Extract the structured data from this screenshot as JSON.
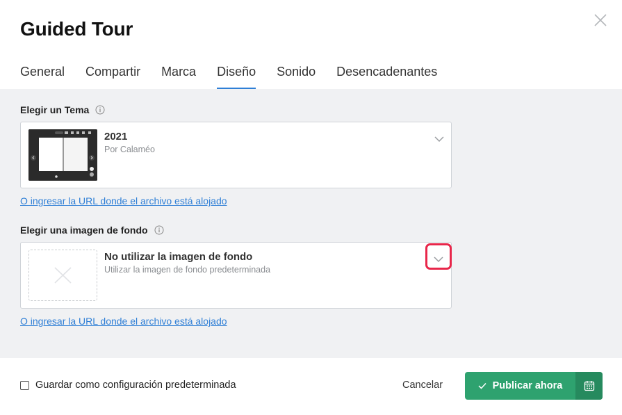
{
  "dialog": {
    "title": "Guided Tour",
    "close_icon": "close-icon"
  },
  "tabs": [
    {
      "label": "General"
    },
    {
      "label": "Compartir"
    },
    {
      "label": "Marca"
    },
    {
      "label": "Diseño",
      "active": true
    },
    {
      "label": "Sonido"
    },
    {
      "label": "Desencadenantes"
    }
  ],
  "theme": {
    "label": "Elegir un Tema",
    "info_icon": "info-icon",
    "name": "2021",
    "author": "Por Calaméo",
    "url_link": "O ingresar la URL donde el archivo está alojado"
  },
  "background": {
    "label": "Elegir una imagen de fondo",
    "info_icon": "info-icon",
    "name": "No utilizar la imagen de fondo",
    "description": "Utilizar la imagen de fondo predeterminada",
    "url_link": "O ingresar la URL donde el archivo está alojado",
    "highlight_color": "#e8264a"
  },
  "footer": {
    "checkbox_label": "Guardar como configuración predeterminada",
    "checkbox_checked": false,
    "cancel_label": "Cancelar",
    "publish_label": "Publicar ahora",
    "calendar_icon": "calendar-icon"
  },
  "colors": {
    "accent": "#2f7fd6",
    "publish": "#2ea26f",
    "publish_dark": "#268a5e",
    "content_bg": "#f0f1f3"
  }
}
